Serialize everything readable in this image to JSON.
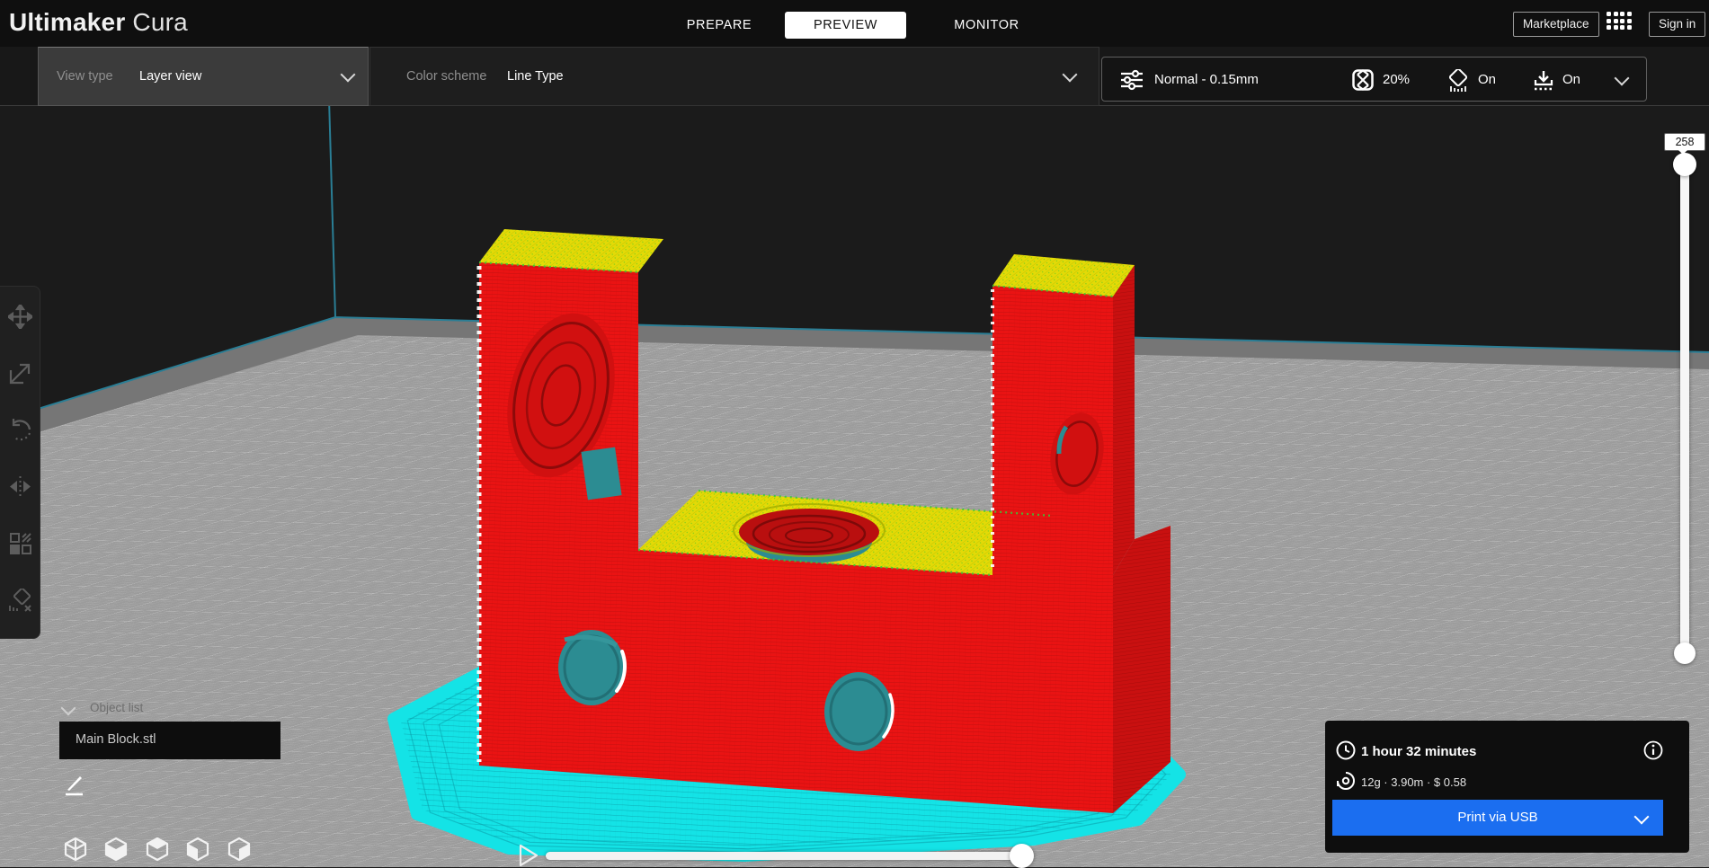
{
  "app": {
    "logo_bold": "Ultimaker",
    "logo_light": "Cura"
  },
  "tabs": {
    "prepare": "PREPARE",
    "preview": "PREVIEW",
    "monitor": "MONITOR"
  },
  "topbar_buttons": {
    "marketplace": "Marketplace",
    "sign_in": "Sign in",
    "apps_icon": "apps-grid-icon"
  },
  "toolbar": {
    "view_type_label": "View type",
    "view_type_value": "Layer view",
    "color_scheme_label": "Color scheme",
    "color_scheme_value": "Line Type",
    "quality": "Normal - 0.15mm",
    "infill": "20%",
    "support": "On",
    "adhesion": "On",
    "icons": [
      "print-settings-sliders-icon",
      "infill-icon",
      "support-icon",
      "adhesion-icon"
    ]
  },
  "left_tools": [
    "move-tool",
    "scale-tool",
    "rotate-tool",
    "mirror-tool",
    "per-model-settings-tool",
    "support-blocker-tool"
  ],
  "object_list": {
    "header": "Object list",
    "items": [
      {
        "name": "Main Block.stl"
      }
    ]
  },
  "camera_views": [
    "3d-view",
    "front-view",
    "top-view",
    "left-view",
    "right-view"
  ],
  "layer_slider": {
    "current_layer": "258"
  },
  "stats": {
    "print_time": "1 hour 32 minutes",
    "material_usage": "12g · 3.90m · $ 0.58",
    "print_button": "Print via USB",
    "icons": [
      "clock-icon",
      "spool-icon",
      "info-icon"
    ]
  },
  "colors": {
    "accent_blue": "#1b6ef0",
    "model_wall_red": "#ea1313",
    "skin_yellow": "#e3da07",
    "skirt_cyan": "#14e3e6",
    "support_teal": "#2c8c92",
    "plate_gray": "#9c9c9c",
    "background": "#1b1b1b"
  }
}
